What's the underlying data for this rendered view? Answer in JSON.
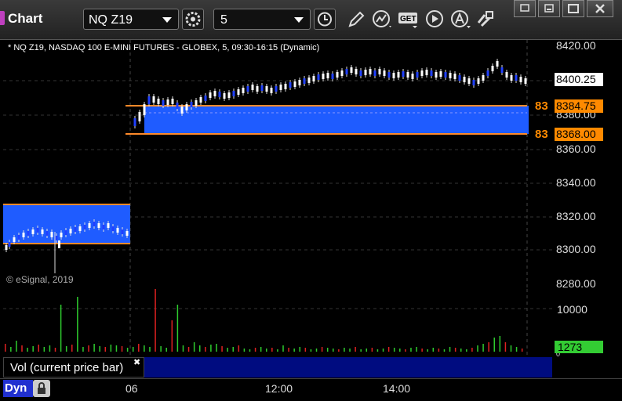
{
  "app": {
    "title": "Chart"
  },
  "toolbar": {
    "symbol": "NQ Z19",
    "interval": "5",
    "get_label": "GET"
  },
  "chart": {
    "header": "* NQ Z19, NASDAQ 100 E-MINI FUTURES - GLOBEX, 5, 09:30-16:15 (Dynamic)",
    "copyright": "© eSignal, 2019",
    "y_ticks": [
      "8420.00",
      "8400.00",
      "8380.00",
      "8360.00",
      "8340.00",
      "8320.00",
      "8300.00",
      "8280.00"
    ],
    "last_price": "8400.25",
    "upper_level": "8384.75",
    "lower_level": "8368.00",
    "level_left_marker": "83",
    "vol_tick": "10000",
    "vol_zero": "0",
    "vol_current": "1273",
    "vol_label": "Vol (current price bar)",
    "x_ticks": [
      "06",
      "12:00",
      "14:00"
    ],
    "dyn_label": "Dyn",
    "colors": {
      "band": "#1f5cff",
      "level_line": "#ff8a2a",
      "price_tag": "#ff8a00",
      "vol_up": "#2ecc2e",
      "vol_down": "#e02020",
      "last_tag": "#ffffff"
    }
  }
}
